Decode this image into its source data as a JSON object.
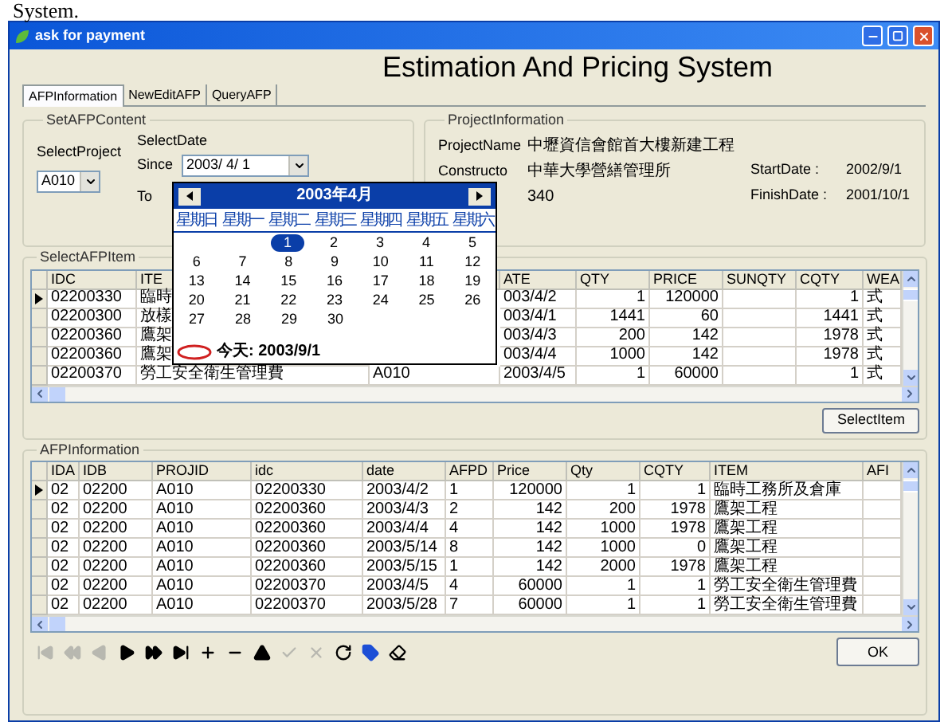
{
  "document_text": "System.",
  "window": {
    "title": "ask for payment"
  },
  "heading": "Estimation And Pricing System",
  "tabs": [
    {
      "label": "AFPInformation",
      "selected": true
    },
    {
      "label": "NewEditAFP",
      "selected": false
    },
    {
      "label": "QueryAFP",
      "selected": false
    }
  ],
  "set_afp_content": {
    "legend": "SetAFPContent",
    "select_project_label": "SelectProject",
    "project": "A010",
    "select_date_label": "SelectDate",
    "since_label": "Since",
    "since": "2003/ 4/ 1",
    "to_label": "To"
  },
  "project_information": {
    "legend": "ProjectInformation",
    "rows": [
      {
        "label": "ProjectName",
        "value": "中壢資信會館首大樓新建工程"
      },
      {
        "label": "Constructo",
        "value": "中華大學營繕管理所",
        "extra_label": "StartDate :",
        "extra_value": "2002/9/1"
      },
      {
        "value": "340",
        "extra_label": "FinishDate :",
        "extra_value": "2001/10/1"
      }
    ]
  },
  "calendar": {
    "month": "2003年4月",
    "weekdays": [
      "星期日",
      "星期一",
      "星期二",
      "星期三",
      "星期四",
      "星期五",
      "星期六"
    ],
    "weeks": [
      [
        {
          "day": "1",
          "selected": true
        },
        {
          "day": "2",
          "selected": false
        },
        {
          "day": "3",
          "selected": false
        },
        {
          "day": "4",
          "selected": false
        },
        {
          "day": "5",
          "selected": false
        }
      ],
      [
        {
          "day": "6",
          "selected": false
        },
        {
          "day": "7",
          "selected": false
        },
        {
          "day": "8",
          "selected": false
        },
        {
          "day": "9",
          "selected": false
        },
        {
          "day": "10",
          "selected": false
        },
        {
          "day": "11",
          "selected": false
        },
        {
          "day": "12",
          "selected": false
        }
      ],
      [
        {
          "day": "13",
          "selected": false
        },
        {
          "day": "14",
          "selected": false
        },
        {
          "day": "15",
          "selected": false
        },
        {
          "day": "16",
          "selected": false
        },
        {
          "day": "17",
          "selected": false
        },
        {
          "day": "18",
          "selected": false
        },
        {
          "day": "19",
          "selected": false
        }
      ],
      [
        {
          "day": "20",
          "selected": false
        },
        {
          "day": "21",
          "selected": false
        },
        {
          "day": "22",
          "selected": false
        },
        {
          "day": "23",
          "selected": false
        },
        {
          "day": "24",
          "selected": false
        },
        {
          "day": "25",
          "selected": false
        },
        {
          "day": "26",
          "selected": false
        }
      ],
      [
        {
          "day": "27",
          "selected": false
        },
        {
          "day": "28",
          "selected": false
        },
        {
          "day": "29",
          "selected": false
        },
        {
          "day": "30",
          "selected": false
        }
      ]
    ],
    "today": "今天: 2003/9/1"
  },
  "select_afp_item": {
    "legend": "SelectAFPItem",
    "columns": [
      "IDC",
      "ITE",
      null,
      "ATE",
      "QTY",
      "PRICE",
      "SUNQTY",
      "CQTY",
      "WEA"
    ],
    "rows": [
      {
        "selected": true,
        "cells": [
          "02200330",
          "臨時",
          null,
          "003/4/2",
          "1",
          "120000",
          null,
          "1",
          "式"
        ]
      },
      {
        "selected": false,
        "cells": [
          "02200300",
          "放樣",
          null,
          "003/4/1",
          "1441",
          "60",
          null,
          "1441",
          "式"
        ]
      },
      {
        "selected": false,
        "cells": [
          "02200360",
          "鷹架",
          null,
          "003/4/3",
          "200",
          "142",
          null,
          "1978",
          "式"
        ]
      },
      {
        "selected": false,
        "cells": [
          "02200360",
          "鷹架",
          null,
          "003/4/4",
          "1000",
          "142",
          null,
          "1978",
          "式"
        ]
      },
      {
        "selected": false,
        "cells": [
          "02200370",
          "勞工安全衛生管理費",
          "A010",
          "2003/4/5",
          "1",
          "60000",
          null,
          "1",
          "式"
        ]
      }
    ],
    "button": "SelectItem"
  },
  "afp_information": {
    "legend": "AFPInformation",
    "columns": [
      "IDA",
      "IDB",
      "PROJID",
      "idc",
      "date",
      "AFPD",
      "Price",
      "Qty",
      "CQTY",
      "ITEM",
      "AFI"
    ],
    "rows": [
      {
        "selected": true,
        "cells": [
          "02",
          "02200",
          "A010",
          "02200330",
          "2003/4/2",
          "1",
          "120000",
          "1",
          "1",
          "臨時工務所及倉庫",
          null
        ]
      },
      {
        "selected": false,
        "cells": [
          "02",
          "02200",
          "A010",
          "02200360",
          "2003/4/3",
          "2",
          "142",
          "200",
          "1978",
          "鷹架工程",
          null
        ]
      },
      {
        "selected": false,
        "cells": [
          "02",
          "02200",
          "A010",
          "02200360",
          "2003/4/4",
          "4",
          "142",
          "1000",
          "1978",
          "鷹架工程",
          null
        ]
      },
      {
        "selected": false,
        "cells": [
          "02",
          "02200",
          "A010",
          "02200360",
          "2003/5/14",
          "8",
          "142",
          "1000",
          "0",
          "鷹架工程",
          null
        ]
      },
      {
        "selected": false,
        "cells": [
          "02",
          "02200",
          "A010",
          "02200360",
          "2003/5/15",
          "1",
          "142",
          "2000",
          "1978",
          "鷹架工程",
          null
        ]
      },
      {
        "selected": false,
        "cells": [
          "02",
          "02200",
          "A010",
          "02200370",
          "2003/4/5",
          "4",
          "60000",
          "1",
          "1",
          "勞工安全衛生管理費",
          null
        ]
      },
      {
        "selected": false,
        "cells": [
          "02",
          "02200",
          "A010",
          "02200370",
          "2003/5/28",
          "7",
          "60000",
          "1",
          "1",
          "勞工安全衛生管理費",
          null
        ]
      }
    ]
  },
  "toolbar": [
    {
      "kind": "first",
      "disabled": true
    },
    {
      "kind": "prior_page",
      "disabled": true
    },
    {
      "kind": "prior",
      "disabled": true
    },
    {
      "kind": "next",
      "disabled": false
    },
    {
      "kind": "next_page",
      "disabled": false
    },
    {
      "kind": "last",
      "disabled": false
    },
    {
      "kind": "insert",
      "disabled": false
    },
    {
      "kind": "delete",
      "disabled": false
    },
    {
      "kind": "edit",
      "disabled": false
    },
    {
      "kind": "post",
      "disabled": true
    },
    {
      "kind": "cancel",
      "disabled": true
    },
    {
      "kind": "refresh",
      "disabled": false
    },
    {
      "kind": "tag",
      "disabled": false
    },
    {
      "kind": "eraser",
      "disabled": false
    }
  ],
  "ok_button": "OK"
}
